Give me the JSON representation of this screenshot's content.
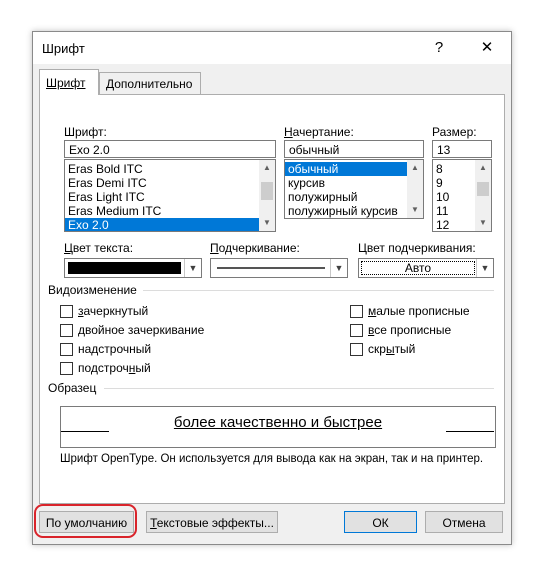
{
  "dialog": {
    "title": "Шрифт",
    "help_label": "?",
    "close_label": "✕"
  },
  "tabs": [
    {
      "label": "Шрифт",
      "active": true
    },
    {
      "label": "Дополнительно",
      "active": false
    }
  ],
  "font": {
    "label": "Шрифт:",
    "value": "Exo 2.0",
    "items": [
      "Eras Bold ITC",
      "Eras Demi ITC",
      "Eras Light ITC",
      "Eras Medium ITC",
      "Exo 2.0"
    ],
    "selected_index": 4
  },
  "style": {
    "label": "Начертание:",
    "value": "обычный",
    "items": [
      "обычный",
      "курсив",
      "полужирный",
      "полужирный курсив"
    ],
    "selected_index": 0
  },
  "size": {
    "label": "Размер:",
    "value": "13",
    "items": [
      "8",
      "9",
      "10",
      "11",
      "12"
    ]
  },
  "text_color": {
    "label": "Цвет текста:",
    "color": "#000000"
  },
  "underline": {
    "label": "Подчеркивание:"
  },
  "underline_color": {
    "label": "Цвет подчеркивания:",
    "value": "Авто"
  },
  "effects": {
    "heading": "Видоизменение",
    "left": [
      {
        "label": "зачеркнутый",
        "checked": false
      },
      {
        "label": "двойное зачеркивание",
        "checked": false
      },
      {
        "label": "надстрочный",
        "checked": false
      },
      {
        "label": "подстрочный",
        "checked": false
      }
    ],
    "right": [
      {
        "label": "малые прописные",
        "checked": false
      },
      {
        "label": "все прописные",
        "checked": false
      },
      {
        "label": "скрытый",
        "checked": false
      }
    ]
  },
  "preview": {
    "heading": "Образец",
    "sample_text": "более качественно и быстрее",
    "note": "Шрифт OpenType. Он используется для вывода как на экран, так и на принтер."
  },
  "buttons": {
    "default_label": "По умолчанию",
    "text_effects_label": "Текстовые эффекты...",
    "ok_label": "ОК",
    "cancel_label": "Отмена"
  },
  "colors": {
    "selection": "#0078d7",
    "highlight_ring": "#d9242b"
  }
}
